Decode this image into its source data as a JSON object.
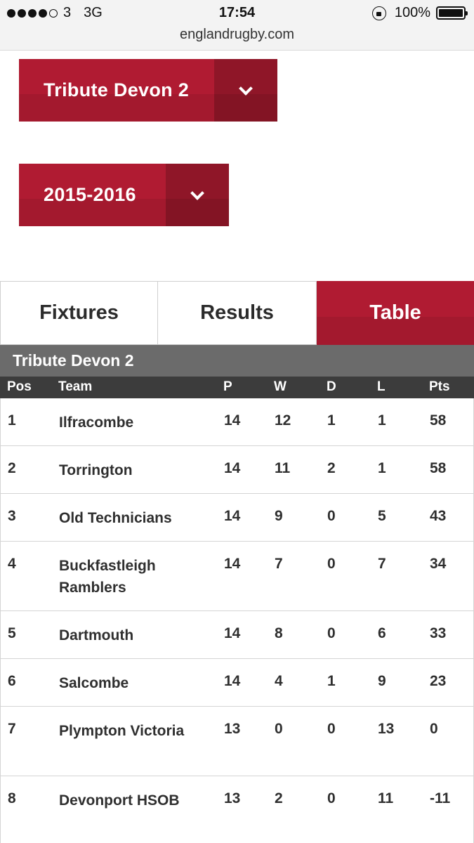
{
  "status_bar": {
    "carrier": "3",
    "network": "3G",
    "time": "17:54",
    "battery": "100%",
    "url": "englandrugby.com"
  },
  "dropdowns": {
    "league": "Tribute Devon 2",
    "season": "2015-2016"
  },
  "tabs": [
    {
      "label": "Fixtures",
      "active": false
    },
    {
      "label": "Results",
      "active": false
    },
    {
      "label": "Table",
      "active": true
    }
  ],
  "table": {
    "league_title": "Tribute Devon 2",
    "headers": {
      "pos": "Pos",
      "team": "Team",
      "p": "P",
      "w": "W",
      "d": "D",
      "l": "L",
      "pts": "Pts"
    },
    "rows": [
      {
        "pos": "1",
        "team": "Ilfracombe",
        "p": "14",
        "w": "12",
        "d": "1",
        "l": "1",
        "pts": "58"
      },
      {
        "pos": "2",
        "team": "Torrington",
        "p": "14",
        "w": "11",
        "d": "2",
        "l": "1",
        "pts": "58"
      },
      {
        "pos": "3",
        "team": "Old Technicians",
        "p": "14",
        "w": "9",
        "d": "0",
        "l": "5",
        "pts": "43"
      },
      {
        "pos": "4",
        "team": "Buckfastleigh Ramblers",
        "p": "14",
        "w": "7",
        "d": "0",
        "l": "7",
        "pts": "34"
      },
      {
        "pos": "5",
        "team": "Dartmouth",
        "p": "14",
        "w": "8",
        "d": "0",
        "l": "6",
        "pts": "33"
      },
      {
        "pos": "6",
        "team": "Salcombe",
        "p": "14",
        "w": "4",
        "d": "1",
        "l": "9",
        "pts": "23"
      },
      {
        "pos": "7",
        "team": "Plympton Victoria",
        "p": "13",
        "w": "0",
        "d": "0",
        "l": "13",
        "pts": "0"
      },
      {
        "pos": "8",
        "team": "Devonport HSOB",
        "p": "13",
        "w": "2",
        "d": "0",
        "l": "11",
        "pts": "-11"
      }
    ]
  },
  "colors": {
    "brand_red": "#b01b32",
    "brand_red_dark": "#8f1628",
    "league_bar": "#6b6b6b",
    "table_header": "#3c3c3c"
  }
}
